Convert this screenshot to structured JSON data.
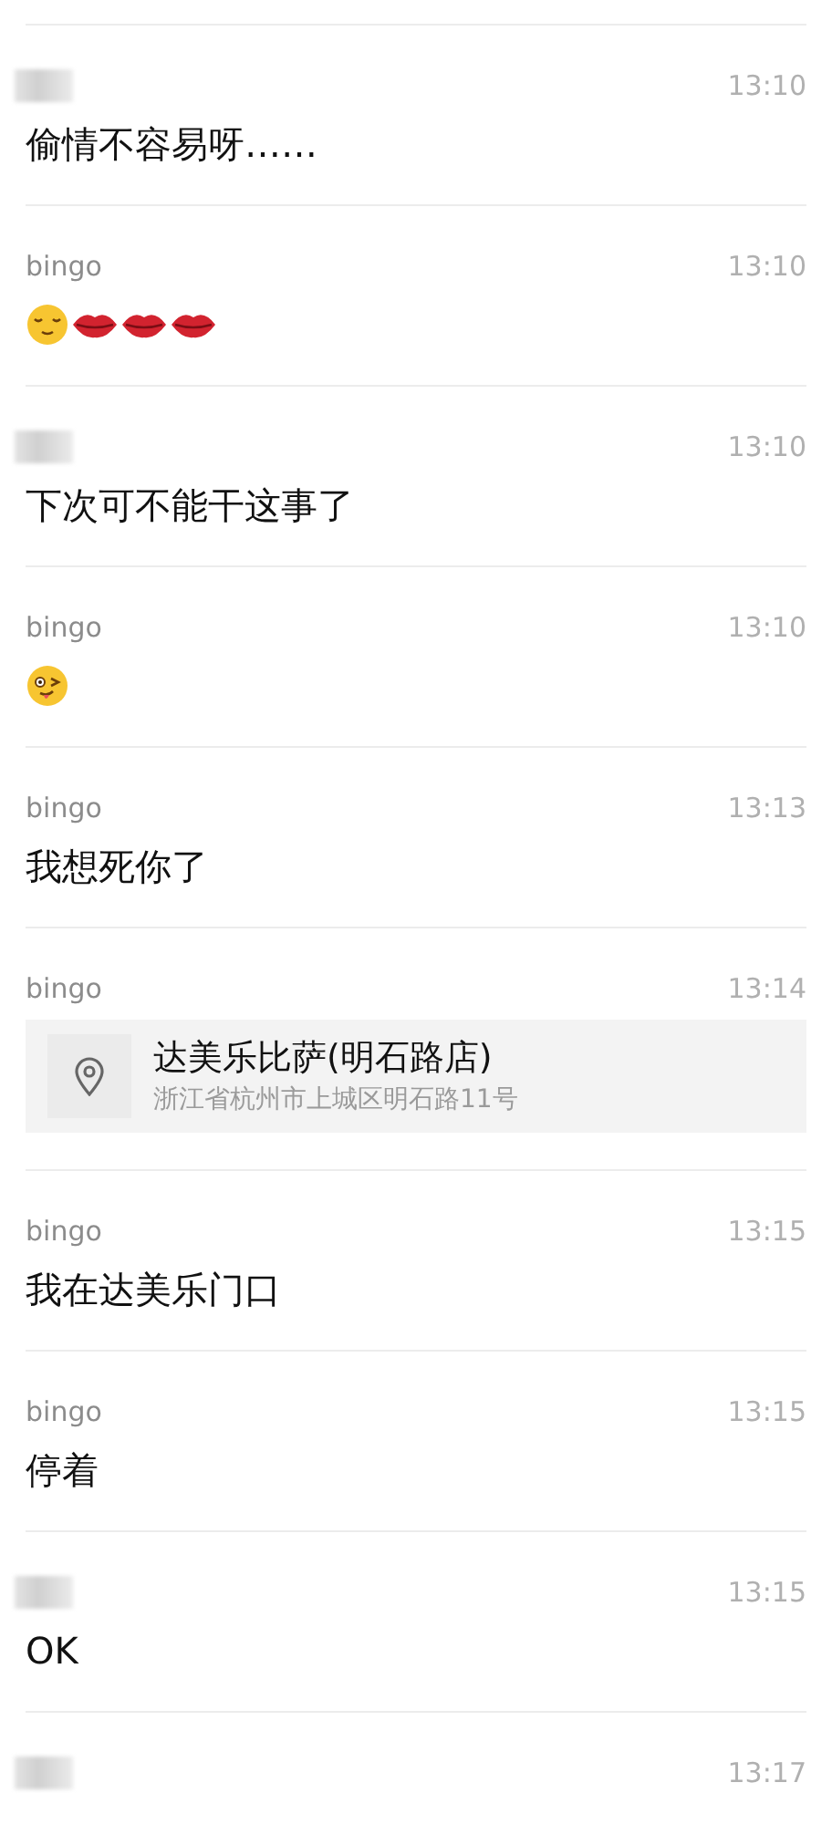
{
  "messages": [
    {
      "sender_hidden": true,
      "time": "13:10",
      "kind": "text",
      "text": "偷情不容易呀……"
    },
    {
      "sender": "bingo",
      "time": "13:10",
      "kind": "emoji",
      "emojis": [
        {
          "kind": "blush"
        },
        {
          "kind": "lips"
        },
        {
          "kind": "lips"
        },
        {
          "kind": "lips"
        }
      ]
    },
    {
      "sender_hidden": true,
      "time": "13:10",
      "kind": "text",
      "text": "下次可不能干这事了"
    },
    {
      "sender": "bingo",
      "time": "13:10",
      "kind": "emoji",
      "emojis": [
        {
          "kind": "wink"
        }
      ]
    },
    {
      "sender": "bingo",
      "time": "13:13",
      "kind": "text",
      "text": "我想死你了"
    },
    {
      "sender": "bingo",
      "time": "13:14",
      "kind": "location",
      "place": "达美乐比萨(明石路店)",
      "address": "浙江省杭州市上城区明石路11号"
    },
    {
      "sender": "bingo",
      "time": "13:15",
      "kind": "text",
      "text": "我在达美乐门口"
    },
    {
      "sender": "bingo",
      "time": "13:15",
      "kind": "text",
      "text": "停着"
    },
    {
      "sender_hidden": true,
      "time": "13:15",
      "kind": "text",
      "text": "OK"
    },
    {
      "sender_hidden": true,
      "time": "13:17",
      "kind": "none"
    }
  ]
}
